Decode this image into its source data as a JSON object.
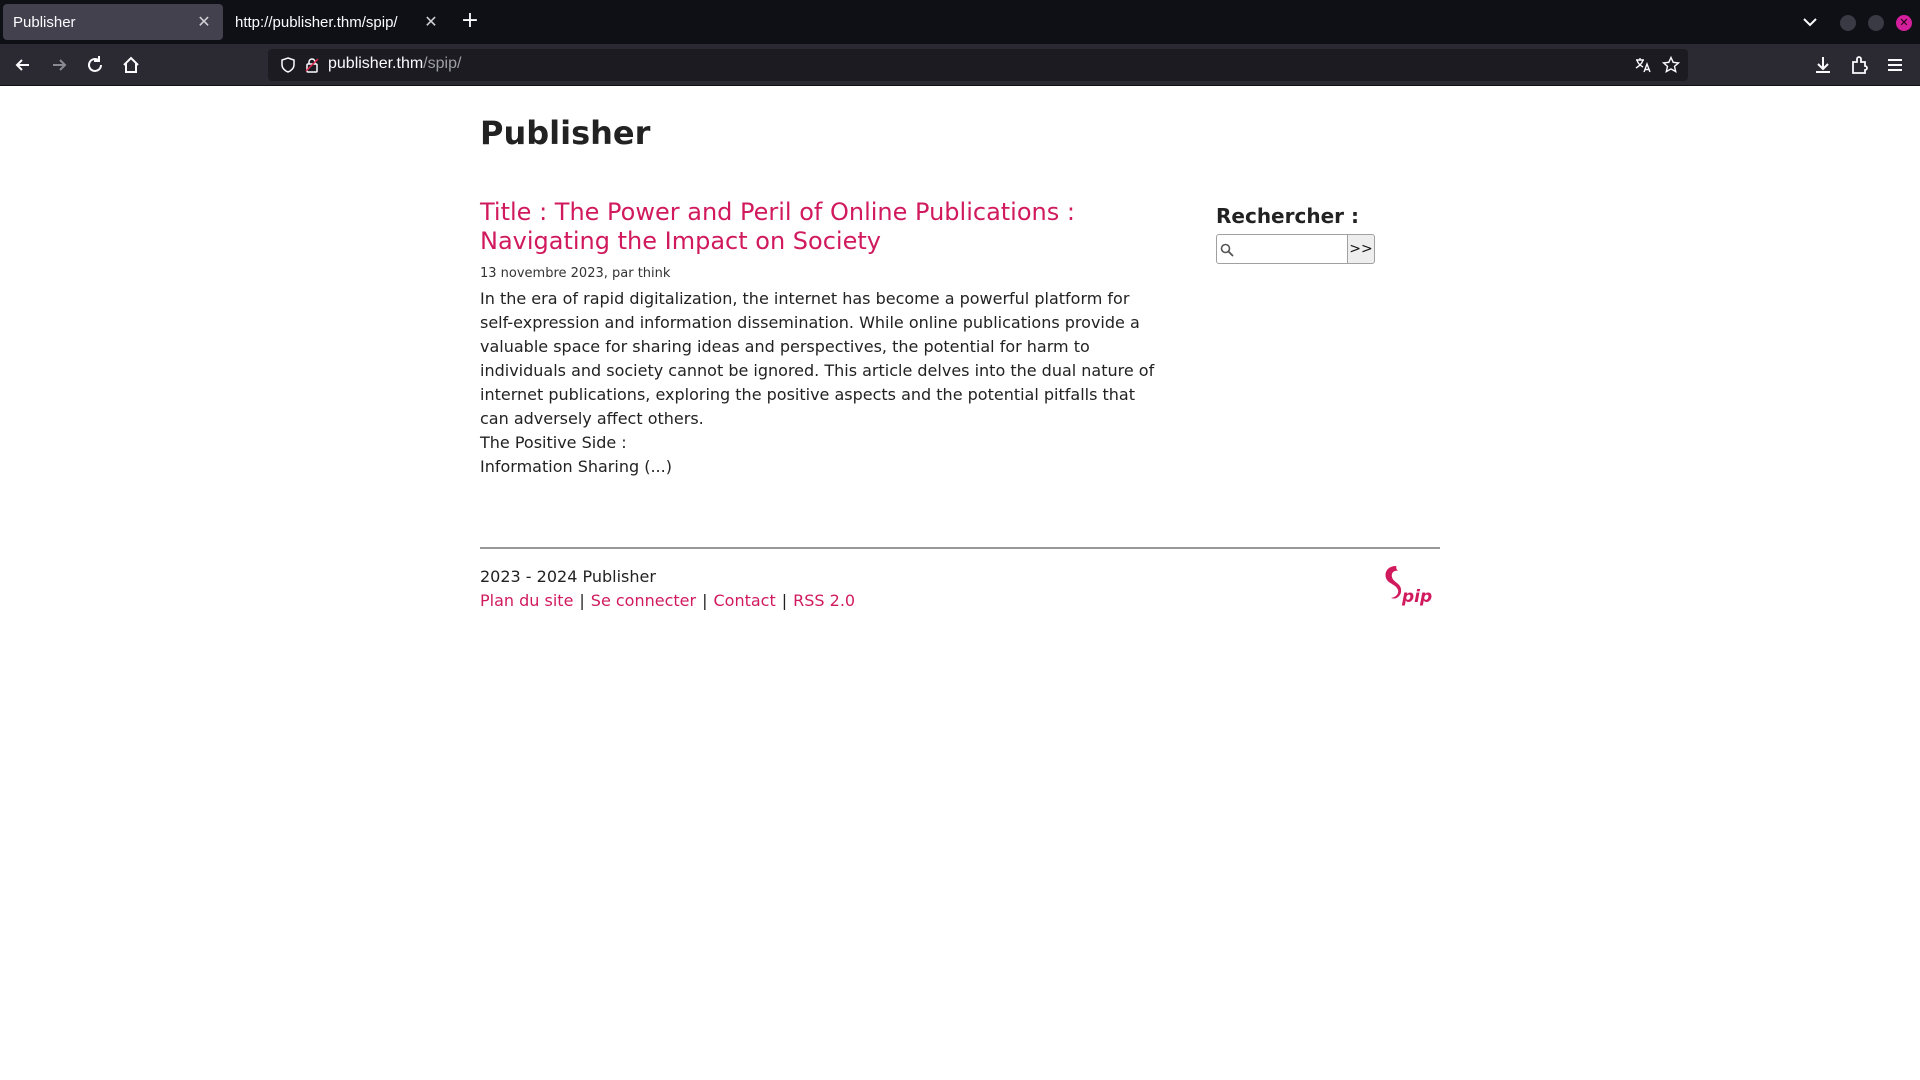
{
  "browser": {
    "tabs": [
      {
        "title": "Publisher",
        "active": true
      },
      {
        "title": "http://publisher.thm/spip/",
        "active": false
      }
    ],
    "url": {
      "host": "publisher.thm",
      "path": "/spip/"
    },
    "accent": "#d41f9c"
  },
  "page": {
    "site_title": "Publisher",
    "article": {
      "title": "Title : The Power and Peril of Online Publications : Navigating the Impact on Society",
      "meta": "13 novembre 2023, par think",
      "body": [
        "In the era of rapid digitalization, the internet has become a powerful platform for self-expression and information dissemination. While online publications provide a valuable space for sharing ideas and perspectives, the potential for harm to individuals and society cannot be ignored. This article delves into the dual nature of internet publications, exploring the positive aspects and the potential pitfalls that can adversely affect others.",
        "The Positive Side :",
        "Information Sharing (...)"
      ]
    },
    "search": {
      "label": "Rechercher :",
      "value": "",
      "button_label": ">>"
    },
    "footer": {
      "copyright": "2023 - 2024 Publisher",
      "links": [
        "Plan du site",
        "Se connecter",
        "Contact",
        "RSS 2.0"
      ],
      "separator": "|",
      "logo_text": "spip"
    },
    "colors": {
      "link": "#d11a5e",
      "text": "#222222"
    }
  }
}
